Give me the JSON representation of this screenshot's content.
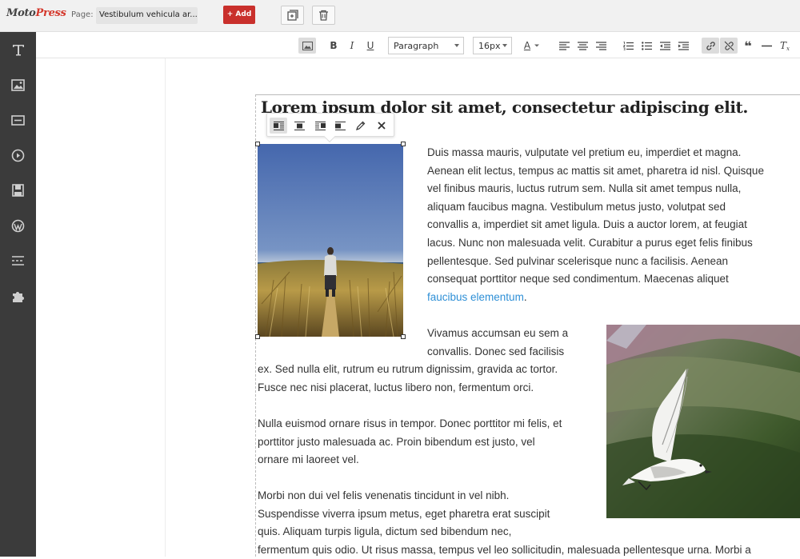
{
  "app": {
    "logo_main": "Moto",
    "logo_accent": "Press",
    "page_label": "Page:",
    "page_value": "Vestibulum vehicula ar...",
    "add_label": "+ Add"
  },
  "toolbar": {
    "paragraph_select": "Paragraph",
    "font_size_select": "16px",
    "bold": "B",
    "italic": "I",
    "underline": "U",
    "text_color": "A",
    "quote": "❝",
    "clear_format": "T"
  },
  "content": {
    "heading": "Lorem ipsum dolor sit amet, consectetur adipiscing elit.",
    "para1_lines": [
      "Duis massa mauris, vulputate vel pretium eu, imperdiet et magna.",
      "Aenean elit lectus, tempus ac mattis sit amet, pharetra id nisl. Quisque",
      "vel finibus mauris, luctus rutrum sem. Nulla sit amet tempus nulla,",
      "aliquam faucibus magna. Vestibulum metus justo, volutpat sed",
      "convallis a, imperdiet sit amet ligula. Duis a auctor lorem, at feugiat",
      "lacus. Nunc non malesuada velit. Curabitur a purus eget felis finibus",
      "pellentesque. Sed pulvinar scelerisque nunc a facilisis. Aenean",
      "consequat porttitor neque sed condimentum. Maecenas aliquet"
    ],
    "para1_link": "faucibus elementum",
    "para1_end": ".",
    "para2_lines": [
      "Vivamus accumsan eu sem a",
      "convallis. Donec sed facilisis"
    ],
    "para2_rest_lines": [
      "ex. Sed nulla elit, rutrum eu rutrum dignissim, gravida ac tortor.",
      "Fusce nec nisi placerat, luctus libero non, fermentum orci."
    ],
    "para3_lines": [
      "Nulla euismod ornare risus in tempor. Donec porttitor mi felis, et",
      "porttitor justo malesuada ac. Proin bibendum est justo, vel",
      "ornare mi laoreet vel."
    ],
    "para4_lines": [
      "Morbi non dui vel felis venenatis tincidunt in vel nibh.",
      "Suspendisse viverra ipsum metus, eget pharetra erat suscipit",
      "quis. Aliquam turpis ligula, dictum sed bibendum nec,",
      "fermentum quis odio. Ut risus massa, tempus vel leo sollicitudin, malesuada pellentesque urna. Morbi a"
    ]
  },
  "sidebar": {
    "items": [
      "text-icon",
      "image-icon",
      "button-icon",
      "video-icon",
      "save-icon",
      "wordpress-icon",
      "divider-icon",
      "plugin-icon"
    ]
  },
  "colors": {
    "add_button": "#c9302c",
    "sidebar": "#3b3b3b",
    "link": "#2e8fd6"
  }
}
